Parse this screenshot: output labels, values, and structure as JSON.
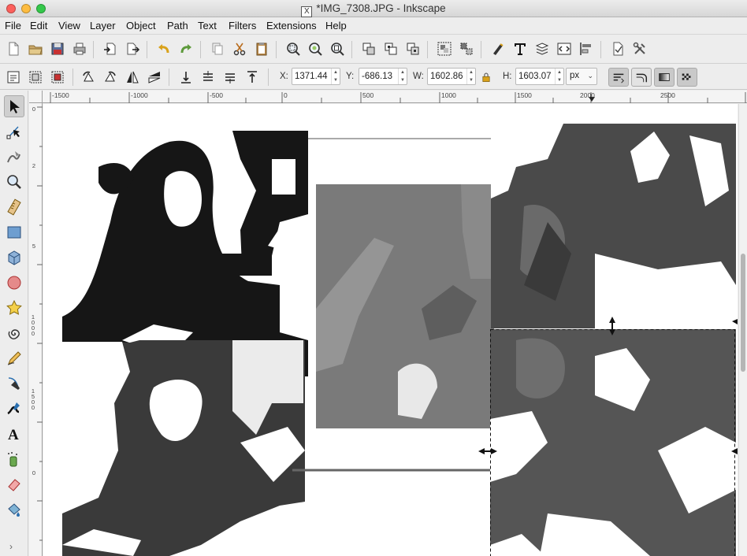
{
  "window": {
    "title": "*IMG_7308.JPG - Inkscape",
    "x11_icon": "X"
  },
  "menu": {
    "items": [
      "File",
      "Edit",
      "View",
      "Layer",
      "Object",
      "Path",
      "Text",
      "Filters",
      "Extensions",
      "Help"
    ]
  },
  "toolbar": {
    "icons": [
      "new-document-icon",
      "open-icon",
      "save-icon",
      "print-icon",
      "import-icon",
      "export-icon",
      "undo-icon",
      "redo-icon",
      "copy-icon",
      "cut-icon",
      "paste-icon",
      "zoom-selection-icon",
      "zoom-drawing-icon",
      "zoom-page-icon",
      "duplicate-icon",
      "clone-icon",
      "unlink-clone-icon",
      "group-icon",
      "ungroup-icon",
      "fill-stroke-icon",
      "text-font-icon",
      "layers-icon",
      "xml-editor-icon",
      "align-distribute-icon",
      "document-properties-icon",
      "preferences-icon"
    ]
  },
  "controls": {
    "x_label": "X:",
    "x_value": "1371.44",
    "y_label": "Y:",
    "y_value": "-686.13",
    "w_label": "W:",
    "w_value": "1602.86",
    "h_label": "H:",
    "h_value": "1603.07",
    "unit": "px",
    "lock_icon": "lock-icon"
  },
  "tools": [
    "selector-tool",
    "node-tool",
    "tweak-tool",
    "zoom-tool",
    "measure-tool",
    "rectangle-tool",
    "3d-box-tool",
    "ellipse-tool",
    "star-tool",
    "spiral-tool",
    "pencil-tool",
    "pen-tool",
    "calligraphy-tool",
    "text-tool",
    "spray-tool",
    "eraser-tool",
    "paint-bucket-tool"
  ],
  "ruler": {
    "h_labels": [
      "-1500",
      "-1000",
      "-500",
      "0",
      "500",
      "1000",
      "1500",
      "2000",
      "2500"
    ],
    "v_labels": [
      "0",
      "2",
      "5",
      "1000",
      "1500",
      "0"
    ]
  },
  "colors": {
    "dark_image": "#161616",
    "mid_dark_image": "#3a3a3a",
    "gray_image": "#7a7a7a",
    "dark_gray_image": "#4a4a4a",
    "light_gray_image": "#555555"
  }
}
